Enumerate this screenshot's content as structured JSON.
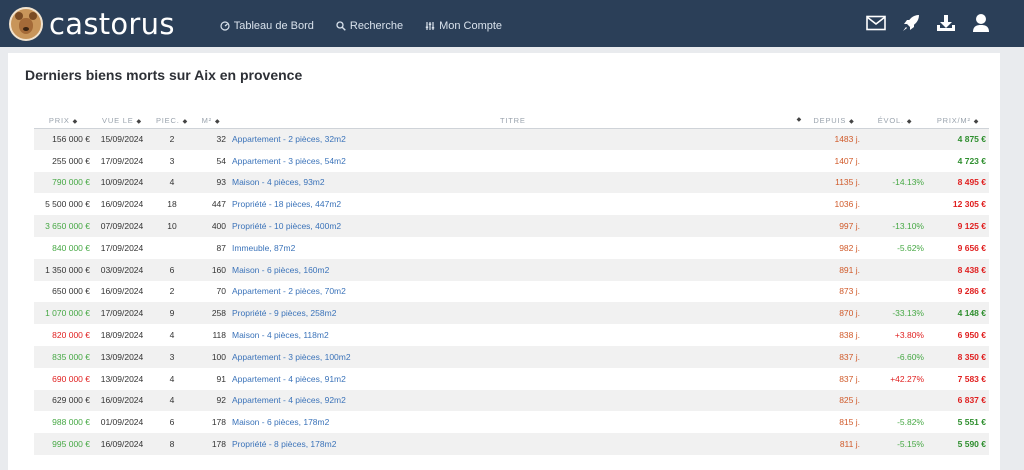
{
  "brand": {
    "name": "castorus"
  },
  "nav": {
    "links": [
      {
        "label": "Tableau de Bord",
        "icon": "dashboard-icon"
      },
      {
        "label": "Recherche",
        "icon": "search-icon"
      },
      {
        "label": "Mon Compte",
        "icon": "sliders-icon"
      }
    ],
    "icons": [
      "mail-icon",
      "rocket-icon",
      "download-icon",
      "user-icon"
    ]
  },
  "page": {
    "title": "Derniers biens morts sur Aix en provence"
  },
  "table": {
    "headers": {
      "prix": "PRIX",
      "vue_le": "VUE LE",
      "piec": "PIEC.",
      "m2": "M²",
      "titre": "TITRE",
      "depuis": "DEPUIS",
      "evol": "ÉVOL.",
      "prix_m2": "PRIX/M²"
    },
    "rows": [
      {
        "prix": "156 000 €",
        "prix_color": "default",
        "vue_le": "15/09/2024",
        "piec": "2",
        "m2": "32",
        "titre": "Appartement - 2 pièces, 32m2",
        "depuis": "1483 j.",
        "evol": "",
        "evol_color": "",
        "prix_m2": "4 875 €",
        "prix_m2_color": "green"
      },
      {
        "prix": "255 000 €",
        "prix_color": "default",
        "vue_le": "17/09/2024",
        "piec": "3",
        "m2": "54",
        "titre": "Appartement - 3 pièces, 54m2",
        "depuis": "1407 j.",
        "evol": "",
        "evol_color": "",
        "prix_m2": "4 723 €",
        "prix_m2_color": "green"
      },
      {
        "prix": "790 000 €",
        "prix_color": "green",
        "vue_le": "10/09/2024",
        "piec": "4",
        "m2": "93",
        "titre": "Maison - 4 pièces, 93m2",
        "depuis": "1135 j.",
        "evol": "-14.13%",
        "evol_color": "green",
        "prix_m2": "8 495 €",
        "prix_m2_color": "red"
      },
      {
        "prix": "5 500 000 €",
        "prix_color": "default",
        "vue_le": "16/09/2024",
        "piec": "18",
        "m2": "447",
        "titre": "Propriété - 18 pièces, 447m2",
        "depuis": "1036 j.",
        "evol": "",
        "evol_color": "",
        "prix_m2": "12 305 €",
        "prix_m2_color": "red"
      },
      {
        "prix": "3 650 000 €",
        "prix_color": "green",
        "vue_le": "07/09/2024",
        "piec": "10",
        "m2": "400",
        "titre": "Propriété - 10 pièces, 400m2",
        "depuis": "997 j.",
        "evol": "-13.10%",
        "evol_color": "green",
        "prix_m2": "9 125 €",
        "prix_m2_color": "red"
      },
      {
        "prix": "840 000 €",
        "prix_color": "green",
        "vue_le": "17/09/2024",
        "piec": "",
        "m2": "87",
        "titre": "Immeuble, 87m2",
        "depuis": "982 j.",
        "evol": "-5.62%",
        "evol_color": "green",
        "prix_m2": "9 656 €",
        "prix_m2_color": "red"
      },
      {
        "prix": "1 350 000 €",
        "prix_color": "default",
        "vue_le": "03/09/2024",
        "piec": "6",
        "m2": "160",
        "titre": "Maison - 6 pièces, 160m2",
        "depuis": "891 j.",
        "evol": "",
        "evol_color": "",
        "prix_m2": "8 438 €",
        "prix_m2_color": "red"
      },
      {
        "prix": "650 000 €",
        "prix_color": "default",
        "vue_le": "16/09/2024",
        "piec": "2",
        "m2": "70",
        "titre": "Appartement - 2 pièces, 70m2",
        "depuis": "873 j.",
        "evol": "",
        "evol_color": "",
        "prix_m2": "9 286 €",
        "prix_m2_color": "red"
      },
      {
        "prix": "1 070 000 €",
        "prix_color": "green",
        "vue_le": "17/09/2024",
        "piec": "9",
        "m2": "258",
        "titre": "Propriété - 9 pièces, 258m2",
        "depuis": "870 j.",
        "evol": "-33.13%",
        "evol_color": "green",
        "prix_m2": "4 148 €",
        "prix_m2_color": "green"
      },
      {
        "prix": "820 000 €",
        "prix_color": "red",
        "vue_le": "18/09/2024",
        "piec": "4",
        "m2": "118",
        "titre": "Maison - 4 pièces, 118m2",
        "depuis": "838 j.",
        "evol": "+3.80%",
        "evol_color": "red",
        "prix_m2": "6 950 €",
        "prix_m2_color": "red"
      },
      {
        "prix": "835 000 €",
        "prix_color": "green",
        "vue_le": "13/09/2024",
        "piec": "3",
        "m2": "100",
        "titre": "Appartement - 3 pièces, 100m2",
        "depuis": "837 j.",
        "evol": "-6.60%",
        "evol_color": "green",
        "prix_m2": "8 350 €",
        "prix_m2_color": "red"
      },
      {
        "prix": "690 000 €",
        "prix_color": "red",
        "vue_le": "13/09/2024",
        "piec": "4",
        "m2": "91",
        "titre": "Appartement - 4 pièces, 91m2",
        "depuis": "837 j.",
        "evol": "+42.27%",
        "evol_color": "red",
        "prix_m2": "7 583 €",
        "prix_m2_color": "red"
      },
      {
        "prix": "629 000 €",
        "prix_color": "default",
        "vue_le": "16/09/2024",
        "piec": "4",
        "m2": "92",
        "titre": "Appartement - 4 pièces, 92m2",
        "depuis": "825 j.",
        "evol": "",
        "evol_color": "",
        "prix_m2": "6 837 €",
        "prix_m2_color": "red"
      },
      {
        "prix": "988 000 €",
        "prix_color": "green",
        "vue_le": "01/09/2024",
        "piec": "6",
        "m2": "178",
        "titre": "Maison - 6 pièces, 178m2",
        "depuis": "815 j.",
        "evol": "-5.82%",
        "evol_color": "green",
        "prix_m2": "5 551 €",
        "prix_m2_color": "green"
      },
      {
        "prix": "995 000 €",
        "prix_color": "green",
        "vue_le": "16/09/2024",
        "piec": "8",
        "m2": "178",
        "titre": "Propriété - 8 pièces, 178m2",
        "depuis": "811 j.",
        "evol": "-5.15%",
        "evol_color": "green",
        "prix_m2": "5 590 €",
        "prix_m2_color": "green"
      }
    ]
  }
}
